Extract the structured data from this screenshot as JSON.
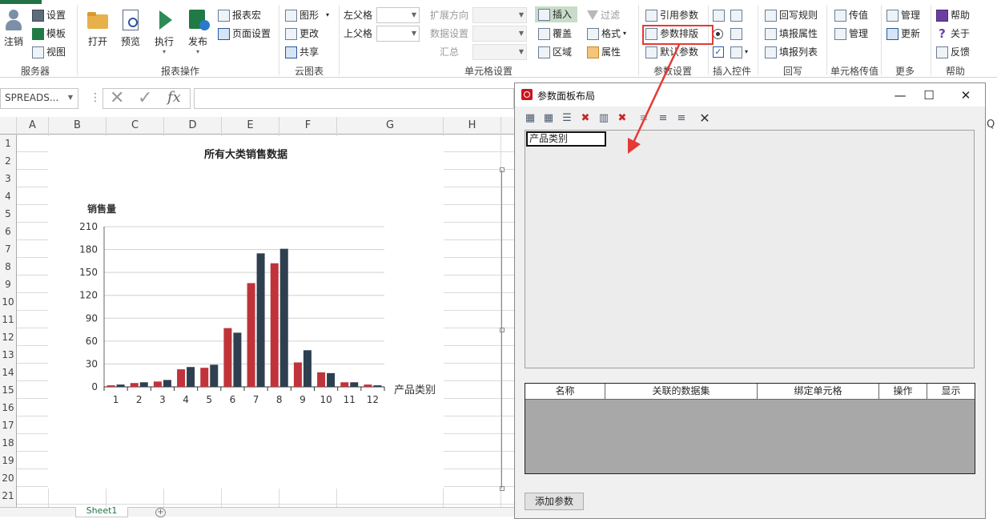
{
  "ribbon": {
    "groups": [
      {
        "label": "服务器",
        "items": [
          "注销",
          "设置",
          "模板",
          "视图"
        ]
      },
      {
        "label": "报表操作",
        "items": [
          "打开",
          "预览",
          "执行",
          "发布",
          "报表宏",
          "页面设置"
        ]
      },
      {
        "label": "云图表",
        "items": [
          "图形",
          "更改",
          "共享"
        ]
      },
      {
        "label": "单元格设置",
        "items": [
          "左父格",
          "上父格",
          "扩展方向",
          "数据设置",
          "汇总",
          "插入",
          "覆盖",
          "区域",
          "过滤",
          "格式",
          "属性"
        ]
      },
      {
        "label": "参数设置",
        "items": [
          "引用参数",
          "参数排版",
          "默认参数"
        ]
      },
      {
        "label": "插入控件",
        "items": []
      },
      {
        "label": "回写",
        "items": [
          "回写规则",
          "填报属性",
          "填报列表"
        ]
      },
      {
        "label": "单元格传值",
        "items": [
          "传值",
          "管理"
        ]
      },
      {
        "label": "更多",
        "items": [
          "管理",
          "更新"
        ]
      },
      {
        "label": "帮助",
        "items": [
          "帮助",
          "关于",
          "反馈"
        ]
      }
    ]
  },
  "formula_bar": {
    "name_box": "SPREADS...",
    "fx": "fx"
  },
  "columns": [
    "A",
    "B",
    "C",
    "D",
    "E",
    "F",
    "G",
    "H"
  ],
  "rows": [
    "1",
    "2",
    "3",
    "4",
    "5",
    "6",
    "7",
    "8",
    "9",
    "10",
    "11",
    "12",
    "13",
    "14",
    "15",
    "16",
    "17",
    "18",
    "19",
    "20",
    "21"
  ],
  "sheet_tab": "Sheet1",
  "chart_data": {
    "type": "bar",
    "title": "所有大类销售数据",
    "xlabel": "产品类别",
    "ylabel": "销售量",
    "categories": [
      "1",
      "2",
      "3",
      "4",
      "5",
      "6",
      "7",
      "8",
      "9",
      "10",
      "11",
      "12"
    ],
    "series": [
      {
        "values": [
          2,
          5,
          7,
          23,
          25,
          77,
          136,
          162,
          32,
          19,
          6,
          3
        ],
        "color": "#c0333a"
      },
      {
        "values": [
          3,
          6,
          9,
          26,
          29,
          71,
          175,
          181,
          48,
          18,
          6,
          2
        ],
        "color": "#2e3f50"
      }
    ],
    "ylim": [
      0,
      210
    ],
    "yticks": [
      0,
      30,
      60,
      90,
      120,
      150,
      180,
      210
    ],
    "grid": true
  },
  "dialog": {
    "title": "参数面板布局",
    "param_chip": "产品类别",
    "table_headers": [
      "名称",
      "关联的数据集",
      "绑定单元格",
      "操作",
      "显示"
    ],
    "add_button": "添加参数"
  }
}
